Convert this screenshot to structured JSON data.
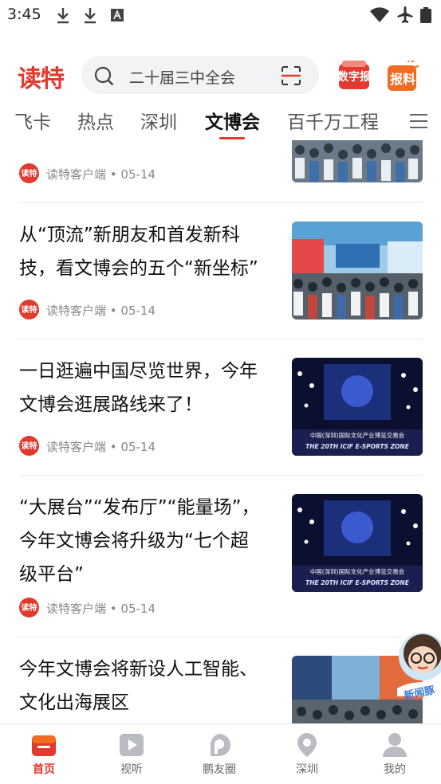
{
  "status_bar": {
    "time": "3:45"
  },
  "header": {
    "logo": "读特",
    "search_placeholder": "二十届三中全会",
    "digital_paper_label": "数字报",
    "report_label": "报料"
  },
  "tabs": [
    {
      "label": "飞卡",
      "active": false
    },
    {
      "label": "热点",
      "active": false
    },
    {
      "label": "深圳",
      "active": false
    },
    {
      "label": "文博会",
      "active": true
    },
    {
      "label": "百千万工程",
      "active": false
    }
  ],
  "feed": [
    {
      "title": "",
      "source": "读特客户端",
      "date": "05-14",
      "thumb": "crowd"
    },
    {
      "title": "从“顶流”新朋友和首发新科技，看文博会的五个“新坐标”",
      "source": "读特客户端",
      "date": "05-14",
      "thumb": "hall"
    },
    {
      "title": "一日逛遍中国尽览世界，今年文博会逛展路线来了！",
      "source": "读特客户端",
      "date": "05-14",
      "thumb": "stage"
    },
    {
      "title": "“大展台”“发布厅”“能量场”，今年文博会将升级为“七个超级平台”",
      "source": "读特客户端",
      "date": "05-14",
      "thumb": "stage"
    },
    {
      "title": "今年文博会将新设人工智能、文化出海展区",
      "source": "",
      "date": "",
      "thumb": "hall"
    }
  ],
  "source_sep": " • ",
  "badge_text": "读特",
  "mascot_text": "新闻豚",
  "stage_text": {
    "banner": "中国(深圳)国际文化产业博览交易会",
    "subtitle": "THE 20TH ICIF E-SPORTS ZONE"
  },
  "bottom_nav": [
    {
      "label": "首页",
      "icon": "home-icon",
      "active": true
    },
    {
      "label": "视听",
      "icon": "play-icon",
      "active": false
    },
    {
      "label": "鹏友圈",
      "icon": "community-icon",
      "active": false
    },
    {
      "label": "深圳",
      "icon": "location-pin-icon",
      "active": false
    },
    {
      "label": "我的",
      "icon": "profile-icon",
      "active": false
    }
  ],
  "colors": {
    "accent": "#e23a2e",
    "orange": "#f26b21"
  }
}
